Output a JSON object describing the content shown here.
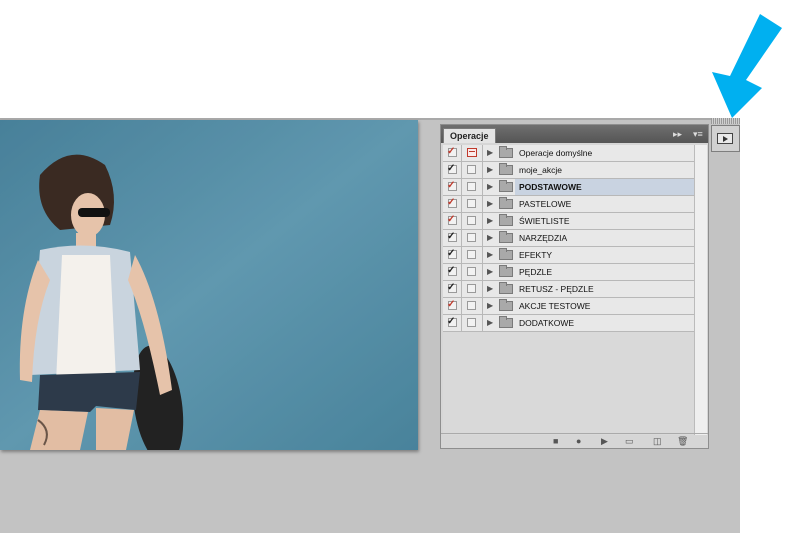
{
  "panel": {
    "tab_label": "Operacje",
    "header_menu_icons": [
      "double-arrow-icon",
      "menu-icon"
    ]
  },
  "actions": [
    {
      "label": "Operacje domyślne",
      "checked": true,
      "check_color": "#c0392b",
      "dialog_toggle": true,
      "selected": false
    },
    {
      "label": "moje_akcje",
      "checked": true,
      "check_color": "#222222",
      "dialog_toggle": false,
      "selected": false
    },
    {
      "label": "PODSTAWOWE",
      "checked": true,
      "check_color": "#c0392b",
      "dialog_toggle": false,
      "selected": true
    },
    {
      "label": "PASTELOWE",
      "checked": true,
      "check_color": "#c0392b",
      "dialog_toggle": false,
      "selected": false
    },
    {
      "label": "ŚWIETLISTE",
      "checked": true,
      "check_color": "#c0392b",
      "dialog_toggle": false,
      "selected": false
    },
    {
      "label": "NARZĘDZIA",
      "checked": true,
      "check_color": "#222222",
      "dialog_toggle": false,
      "selected": false
    },
    {
      "label": "EFEKTY",
      "checked": true,
      "check_color": "#222222",
      "dialog_toggle": false,
      "selected": false
    },
    {
      "label": "PĘDZLE",
      "checked": true,
      "check_color": "#222222",
      "dialog_toggle": false,
      "selected": false
    },
    {
      "label": "RETUSZ - PĘDZLE",
      "checked": true,
      "check_color": "#222222",
      "dialog_toggle": false,
      "selected": false
    },
    {
      "label": "AKCJE TESTOWE",
      "checked": true,
      "check_color": "#c0392b",
      "dialog_toggle": false,
      "selected": false
    },
    {
      "label": "DODATKOWE",
      "checked": true,
      "check_color": "#222222",
      "dialog_toggle": false,
      "selected": false
    }
  ],
  "footer_icons": [
    "stop-icon",
    "record-icon",
    "play-icon",
    "new-set-icon",
    "new-action-icon",
    "delete-icon"
  ],
  "collapsed_panel_button_icon": "actions-panel-icon",
  "annotation_arrow_color": "#00b0f0"
}
